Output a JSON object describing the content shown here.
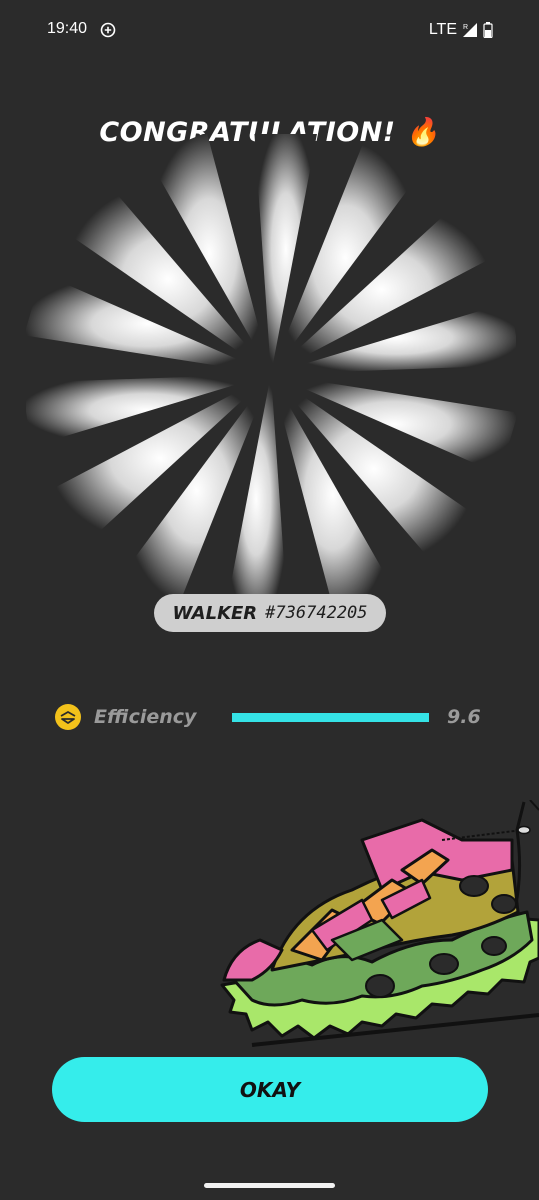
{
  "status_bar": {
    "time": "19:40",
    "network": "LTE",
    "roaming": "R",
    "icons": [
      "add-circle-icon",
      "signal-icon",
      "battery-icon"
    ]
  },
  "title": "CONGRATULATION!",
  "title_emoji": "🔥",
  "walker": {
    "name": "WALKER",
    "id": "#736742205"
  },
  "attribute": {
    "icon": "efficiency-icon",
    "label": "Efficiency",
    "value": "9.6",
    "fill_fraction": 1.0
  },
  "okay_label": "OKAY",
  "colors": {
    "background": "#2b2b2b",
    "accent": "#35edeb",
    "efficiency_icon": "#f3c21b",
    "pill": "#cfcfcf"
  }
}
